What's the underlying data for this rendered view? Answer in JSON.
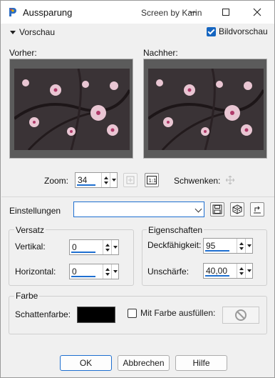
{
  "window": {
    "title": "Aussparung",
    "credit": "Screen by Karin"
  },
  "preview": {
    "toggle_label": "Vorschau",
    "live_preview_label": "Bildvorschau",
    "live_preview_checked": true,
    "before_label": "Vorher:",
    "after_label": "Nachher:",
    "zoom_label": "Zoom:",
    "zoom_value": "34",
    "pan_label": "Schwenken:"
  },
  "settings": {
    "label": "Einstellungen",
    "preset_value": ""
  },
  "offset": {
    "group_title": "Versatz",
    "vertical_label": "Vertikal:",
    "vertical_value": "0",
    "horizontal_label": "Horizontal:",
    "horizontal_value": "0"
  },
  "properties": {
    "group_title": "Eigenschaften",
    "opacity_label": "Deckfähigkeit:",
    "opacity_value": "95",
    "blur_label": "Unschärfe:",
    "blur_value": "40,00"
  },
  "color": {
    "group_title": "Farbe",
    "shadow_color_label": "Schattenfarbe:",
    "shadow_color": "#000000",
    "fill_label": "Mit Farbe ausfüllen:",
    "fill_checked": false
  },
  "footer": {
    "ok_label": "OK",
    "cancel_label": "Abbrechen",
    "help_label": "Hilfe"
  },
  "colors": {
    "accent": "#1e6fd0",
    "preview_bg": "#5b5b5b"
  },
  "icons": {
    "app": "paint-palette-icon",
    "minimize": "minimize-icon",
    "maximize": "maximize-icon",
    "close": "close-icon",
    "fit": "zoom-fit-icon",
    "actual_size": "actual-size-icon",
    "pan": "move-icon",
    "save_preset": "save-icon",
    "random": "dice-icon",
    "reset": "reset-icon",
    "no_color": "no-color-icon"
  }
}
